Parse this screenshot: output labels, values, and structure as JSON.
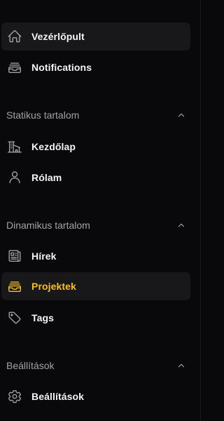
{
  "colors": {
    "background": "#09090b",
    "active_item_bg": "#18181b",
    "text_primary": "#f4f4f5",
    "text_muted": "#a1a1aa",
    "icon": "#a1a1aa",
    "accent": "#fbbf24"
  },
  "top_items": [
    {
      "label": "Vezérlőpult",
      "icon": "home-icon",
      "active": true
    },
    {
      "label": "Notifications",
      "icon": "inbox-stack-icon",
      "active": false
    }
  ],
  "groups": [
    {
      "label": "Statikus tartalom",
      "expanded": true,
      "items": [
        {
          "label": "Kezdőlap",
          "icon": "building-icon"
        },
        {
          "label": "Rólam",
          "icon": "user-icon"
        }
      ]
    },
    {
      "label": "Dinamikus tartalom",
      "expanded": true,
      "items": [
        {
          "label": "Hírek",
          "icon": "newspaper-icon"
        },
        {
          "label": "Projektek",
          "icon": "inbox-stack-icon",
          "active": true
        },
        {
          "label": "Tags",
          "icon": "tag-icon"
        }
      ]
    },
    {
      "label": "Beállítások",
      "expanded": true,
      "items": [
        {
          "label": "Beállítások",
          "icon": "gear-icon"
        }
      ]
    }
  ]
}
